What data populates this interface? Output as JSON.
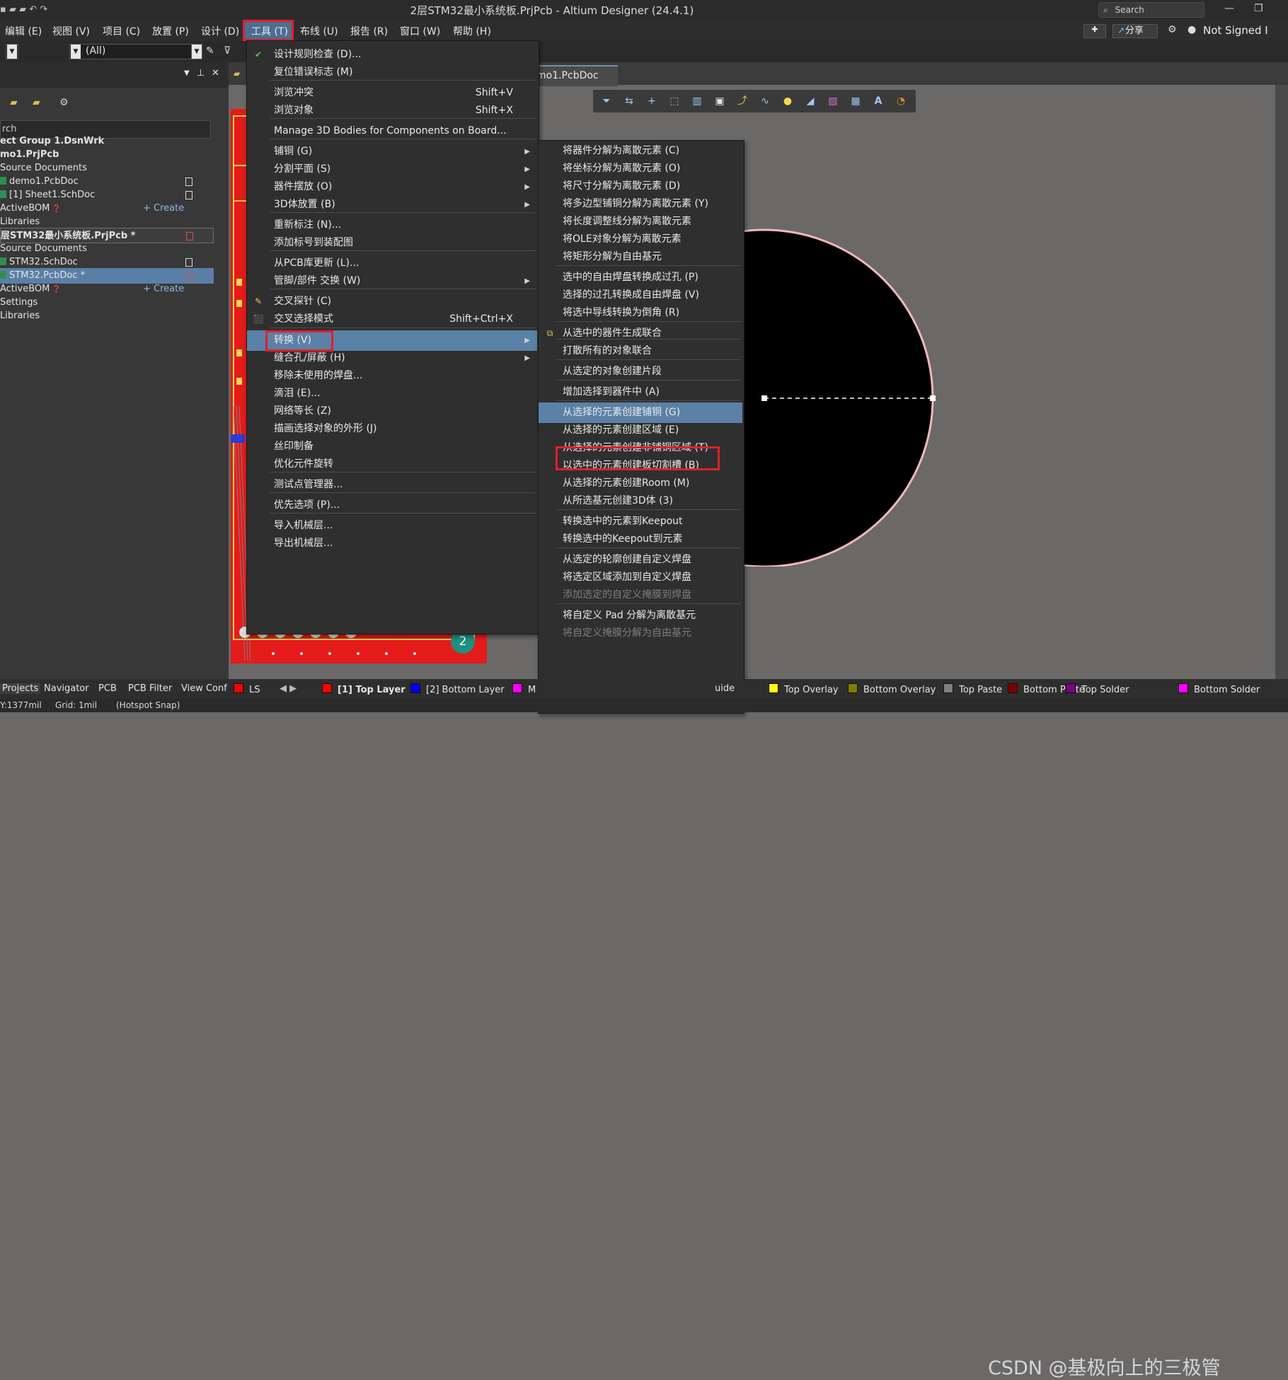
{
  "window": {
    "title": "2层STM32最小系统板.PrjPcb - Altium Designer (24.4.1)",
    "search_placeholder": "Search",
    "share_label": "分享",
    "user_label": "Not Signed I"
  },
  "menubar": [
    "编辑 (E)",
    "视图 (V)",
    "项目 (C)",
    "放置 (P)",
    "设计 (D)",
    "工具 (T)",
    "布线 (U)",
    "报告 (R)",
    "窗口 (W)",
    "帮助 (H)"
  ],
  "toolbar2": {
    "filter_value": "(All)"
  },
  "doc_tab": "mo1.PcbDoc",
  "projects": {
    "search_text": "rch",
    "tree": [
      {
        "text": "ect Group 1.DsnWrk",
        "style": "bold"
      },
      {
        "text": "mo1.PrjPcb",
        "style": "bold"
      },
      {
        "text": "Source Documents",
        "style": ""
      },
      {
        "text": "demo1.PcbDoc",
        "style": "file"
      },
      {
        "text": "[1] Sheet1.SchDoc",
        "style": "file"
      },
      {
        "text": "ActiveBOM",
        "style": "bom",
        "action": "+ Create"
      },
      {
        "text": "Libraries",
        "style": ""
      },
      {
        "text": "层STM32最小系统板.PrjPcb *",
        "style": "bold outline"
      },
      {
        "text": "Source Documents",
        "style": ""
      },
      {
        "text": "STM32.SchDoc",
        "style": "file"
      },
      {
        "text": "STM32.PcbDoc *",
        "style": "file sel"
      },
      {
        "text": "ActiveBOM",
        "style": "bom",
        "action": "+ Create"
      },
      {
        "text": "Settings",
        "style": ""
      },
      {
        "text": "Libraries",
        "style": ""
      }
    ]
  },
  "tools_menu": [
    {
      "label": "设计规则检查 (D)...",
      "shortcut": "",
      "submenu": false
    },
    {
      "label": "复位错误标志 (M)",
      "shortcut": "",
      "submenu": false
    },
    {
      "label": "浏览冲突",
      "shortcut": "Shift+V",
      "submenu": false
    },
    {
      "label": "浏览对象",
      "shortcut": "Shift+X",
      "submenu": false
    },
    {
      "label": "Manage 3D Bodies for Components on Board...",
      "shortcut": "",
      "submenu": false
    },
    {
      "label": "铺铜 (G)",
      "shortcut": "",
      "submenu": true
    },
    {
      "label": "分割平面 (S)",
      "shortcut": "",
      "submenu": true
    },
    {
      "label": "器件摆放 (O)",
      "shortcut": "",
      "submenu": true
    },
    {
      "label": "3D体放置 (B)",
      "shortcut": "",
      "submenu": true
    },
    {
      "label": "重新标注 (N)...",
      "shortcut": "",
      "submenu": false
    },
    {
      "label": "添加标号到装配图",
      "shortcut": "",
      "submenu": false
    },
    {
      "label": "从PCB库更新 (L)...",
      "shortcut": "",
      "submenu": false
    },
    {
      "label": "管脚/部件 交换 (W)",
      "shortcut": "",
      "submenu": true
    },
    {
      "label": "交叉探针 (C)",
      "shortcut": "",
      "submenu": false
    },
    {
      "label": "交叉选择模式",
      "shortcut": "Shift+Ctrl+X",
      "submenu": false
    },
    {
      "label": "转换 (V)",
      "shortcut": "",
      "submenu": true
    },
    {
      "label": "缝合孔/屏蔽 (H)",
      "shortcut": "",
      "submenu": true
    },
    {
      "label": "移除未使用的焊盘...",
      "shortcut": "",
      "submenu": false
    },
    {
      "label": "滴泪 (E)...",
      "shortcut": "",
      "submenu": false
    },
    {
      "label": "网络等长 (Z)",
      "shortcut": "",
      "submenu": false
    },
    {
      "label": "描画选择对象的外形 (J)",
      "shortcut": "",
      "submenu": false
    },
    {
      "label": "丝印制备",
      "shortcut": "",
      "submenu": false
    },
    {
      "label": "优化元件旋转",
      "shortcut": "",
      "submenu": false
    },
    {
      "label": "测试点管理器...",
      "shortcut": "",
      "submenu": false
    },
    {
      "label": "优先选项 (P)...",
      "shortcut": "",
      "submenu": false
    },
    {
      "label": "导入机械层...",
      "shortcut": "",
      "submenu": false
    },
    {
      "label": "导出机械层...",
      "shortcut": "",
      "submenu": false
    }
  ],
  "convert_menu": [
    {
      "label": "将器件分解为离散元素 (C)",
      "disabled": false
    },
    {
      "label": "将坐标分解为离散元素 (O)",
      "disabled": false
    },
    {
      "label": "将尺寸分解为离散元素 (D)",
      "disabled": false
    },
    {
      "label": "将多边型铺铜分解为离散元素 (Y)",
      "disabled": false
    },
    {
      "label": "将长度调整线分解为离散元素",
      "disabled": false
    },
    {
      "label": "将OLE对象分解为离散元素",
      "disabled": false
    },
    {
      "label": "将矩形分解为自由基元",
      "disabled": false
    },
    {
      "label": "选中的自由焊盘转换成过孔 (P)",
      "disabled": false
    },
    {
      "label": "选择的过孔转换成自由焊盘 (V)",
      "disabled": false
    },
    {
      "label": "将选中导线转换为倒角 (R)",
      "disabled": false
    },
    {
      "label": "从选中的器件生成联合",
      "disabled": false
    },
    {
      "label": "打散所有的对象联合",
      "disabled": false
    },
    {
      "label": "从选定的对象创建片段",
      "disabled": false
    },
    {
      "label": "增加选择到器件中 (A)",
      "disabled": false
    },
    {
      "label": "从选择的元素创建铺铜 (G)",
      "disabled": false
    },
    {
      "label": "从选择的元素创建区域 (E)",
      "disabled": false
    },
    {
      "label": "从选择的元素创建非铺铜区域 (T)",
      "disabled": false
    },
    {
      "label": "以选中的元素创建板切割槽 (B)",
      "disabled": false
    },
    {
      "label": "从选择的元素创建Room (M)",
      "disabled": false
    },
    {
      "label": "从所选基元创建3D体 (3)",
      "disabled": false
    },
    {
      "label": "转换选中的元素到Keepout",
      "disabled": false
    },
    {
      "label": "转换选中的Keepout到元素",
      "disabled": false
    },
    {
      "label": "从选定的轮廓创建自定义焊盘",
      "disabled": false
    },
    {
      "label": "将选定区域添加到自定义焊盘",
      "disabled": false
    },
    {
      "label": "添加选定的自定义掩膜到焊盘",
      "disabled": true
    },
    {
      "label": "将自定义 Pad 分解为离散基元",
      "disabled": false
    },
    {
      "label": "将自定义掩膜分解为自由基元",
      "disabled": true
    }
  ],
  "bottom_tabs": [
    "Projects",
    "Navigator",
    "PCB",
    "PCB Filter",
    "View Conf"
  ],
  "layers": [
    {
      "name": "LS",
      "color": "#ff0000"
    },
    {
      "name": "[1] Top Layer",
      "color": "#ff0000"
    },
    {
      "name": "[2] Bottom Layer",
      "color": "#0000ff"
    },
    {
      "name": "M",
      "color": "#ff00ff"
    },
    {
      "name": "uide",
      "color": ""
    },
    {
      "name": "Top Overlay",
      "color": "#ffff00"
    },
    {
      "name": "Bottom Overlay",
      "color": "#808000"
    },
    {
      "name": "Top Paste",
      "color": "#808080"
    },
    {
      "name": "Bottom Paste",
      "color": "#800000"
    },
    {
      "name": "Top Solder",
      "color": "#800080"
    },
    {
      "name": "Bottom Solder",
      "color": "#ff00ff"
    }
  ],
  "status": {
    "coords": "Y:1377mil",
    "grid": "Grid: 1mil",
    "snap": "(Hotspot Snap)"
  },
  "badge_number": "2",
  "watermark": "CSDN @基极向上的三极管"
}
